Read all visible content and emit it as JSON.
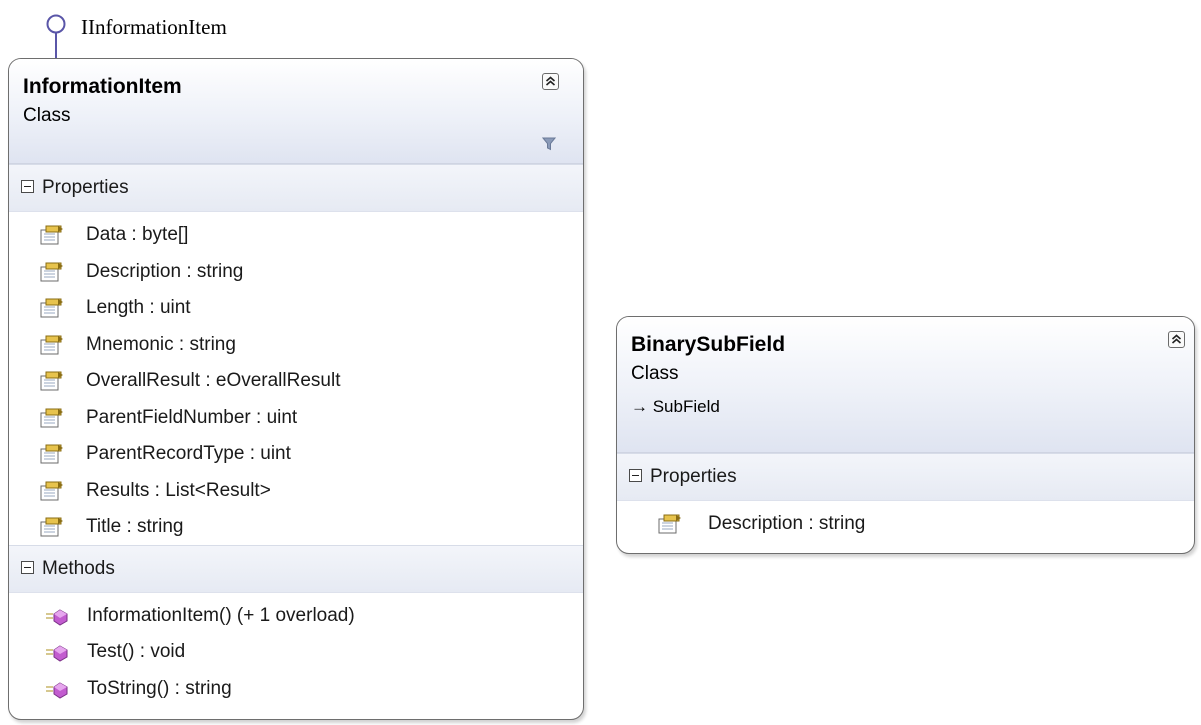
{
  "interface": {
    "name": "IInformationItem"
  },
  "information_item": {
    "name": "InformationItem",
    "kind": "Class",
    "properties_section": "Properties",
    "properties": [
      "Data : byte[]",
      "Description : string",
      "Length : uint",
      "Mnemonic : string",
      "OverallResult : eOverallResult",
      "ParentFieldNumber : uint",
      "ParentRecordType : uint",
      "Results : List<Result>",
      "Title : string"
    ],
    "methods_section": "Methods",
    "methods": [
      "InformationItem() (+ 1 overload)",
      "Test() : void",
      "ToString() : string"
    ]
  },
  "binary_sub_field": {
    "name": "BinarySubField",
    "kind": "Class",
    "base": "→ SubField",
    "properties_section": "Properties",
    "properties": [
      "Description : string"
    ]
  },
  "colors": {
    "header_gradient_end": "#dfe4f1",
    "interface_stroke": "#5a56a8",
    "method_icon": "#c25ccf"
  },
  "icons": {
    "interface": "interface-lollipop-icon",
    "collapse": "double-chevron-up-icon",
    "filter": "filter-funnel-icon",
    "section_toggle": "minus-box-icon",
    "property": "property-icon",
    "method": "method-icon"
  }
}
